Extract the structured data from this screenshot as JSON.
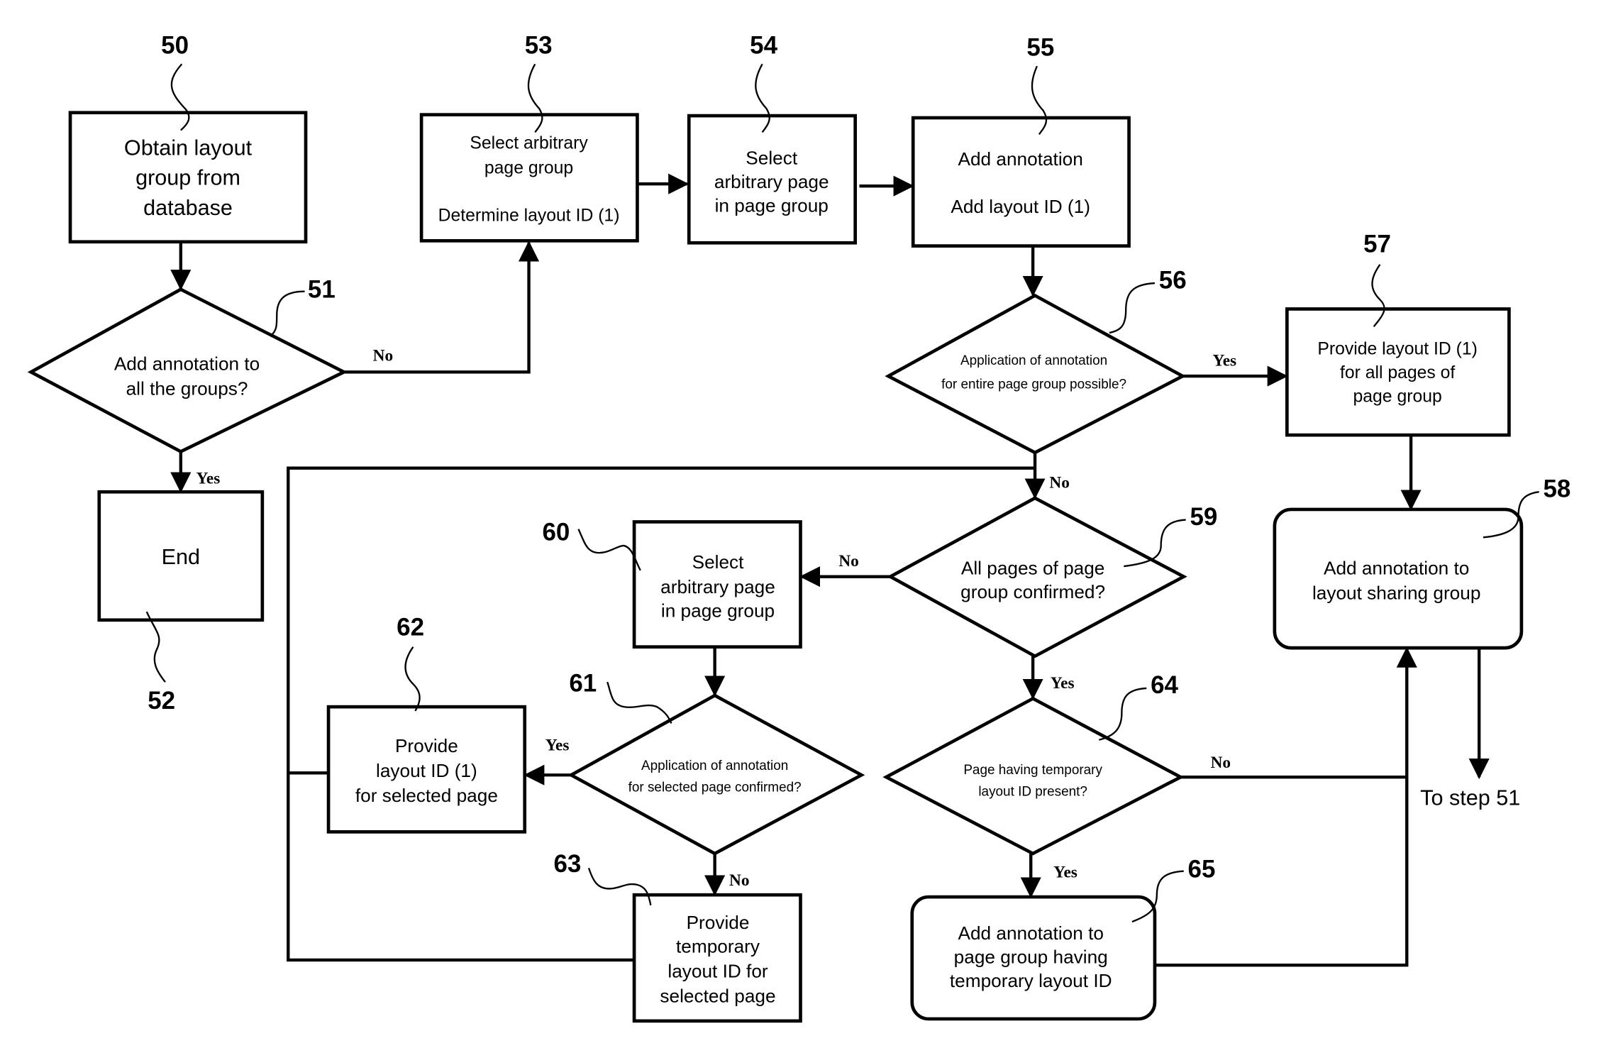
{
  "figure": {
    "type": "flowchart",
    "colors": {
      "line": "#000000",
      "background": "#ffffff"
    }
  },
  "steps": {
    "s50": {
      "ref": "50",
      "shape": "process",
      "lines": [
        "Obtain layout",
        "group from",
        "database"
      ]
    },
    "s51": {
      "ref": "51",
      "shape": "decision",
      "lines": [
        "Add annotation to",
        "all the groups?"
      ]
    },
    "s52": {
      "ref": "52",
      "shape": "terminal",
      "lines": [
        "End"
      ]
    },
    "s53": {
      "ref": "53",
      "shape": "process",
      "lines": [
        "Select arbitrary",
        "page group",
        "Determine layout ID (1)"
      ]
    },
    "s54": {
      "ref": "54",
      "shape": "process",
      "lines": [
        "Select",
        "arbitrary page",
        "in page group"
      ]
    },
    "s55": {
      "ref": "55",
      "shape": "process",
      "lines": [
        "Add annotation",
        "Add layout ID (1)"
      ]
    },
    "s56": {
      "ref": "56",
      "shape": "decision",
      "lines": [
        "Application of annotation",
        "for entire page group possible?"
      ]
    },
    "s57": {
      "ref": "57",
      "shape": "process",
      "lines": [
        "Provide layout ID (1)",
        "for all pages of",
        "page group"
      ]
    },
    "s58": {
      "ref": "58",
      "shape": "rounded-process",
      "lines": [
        "Add annotation to",
        "layout sharing group"
      ]
    },
    "s59": {
      "ref": "59",
      "shape": "decision",
      "lines": [
        "All pages of page",
        "group confirmed?"
      ]
    },
    "s60": {
      "ref": "60",
      "shape": "process",
      "lines": [
        "Select",
        "arbitrary page",
        "in page group"
      ]
    },
    "s61": {
      "ref": "61",
      "shape": "decision",
      "lines": [
        "Application of annotation",
        "for selected page confirmed?"
      ]
    },
    "s62": {
      "ref": "62",
      "shape": "process",
      "lines": [
        "Provide",
        "layout ID (1)",
        "for selected page"
      ]
    },
    "s63": {
      "ref": "63",
      "shape": "process",
      "lines": [
        "Provide",
        "temporary",
        "layout ID for",
        "selected page"
      ]
    },
    "s64": {
      "ref": "64",
      "shape": "decision",
      "lines": [
        "Page having temporary",
        "layout ID present?"
      ]
    },
    "s65": {
      "ref": "65",
      "shape": "rounded-process",
      "lines": [
        "Add annotation to",
        "page group having",
        "temporary layout ID"
      ]
    }
  },
  "branch_labels": {
    "s51_no": "No",
    "s51_yes": "Yes",
    "s56_yes": "Yes",
    "s56_no": "No",
    "s59_no": "No",
    "s59_yes": "Yes",
    "s61_yes": "Yes",
    "s61_no": "No",
    "s64_no": "No",
    "s64_yes": "Yes"
  },
  "connectors": [
    {
      "from": "50",
      "to": "51"
    },
    {
      "from": "51",
      "to": "53",
      "label": "No"
    },
    {
      "from": "51",
      "to": "52",
      "label": "Yes"
    },
    {
      "from": "53",
      "to": "54"
    },
    {
      "from": "54",
      "to": "55"
    },
    {
      "from": "55",
      "to": "56"
    },
    {
      "from": "56",
      "to": "57",
      "label": "Yes"
    },
    {
      "from": "56",
      "to": "59",
      "label": "No"
    },
    {
      "from": "57",
      "to": "58"
    },
    {
      "from": "59",
      "to": "60",
      "label": "No"
    },
    {
      "from": "59",
      "to": "64",
      "label": "Yes"
    },
    {
      "from": "60",
      "to": "61"
    },
    {
      "from": "61",
      "to": "62",
      "label": "Yes"
    },
    {
      "from": "61",
      "to": "63",
      "label": "No"
    },
    {
      "from": "62",
      "to": "59"
    },
    {
      "from": "63",
      "to": "59"
    },
    {
      "from": "64",
      "to": "58",
      "label": "No"
    },
    {
      "from": "64",
      "to": "65",
      "label": "Yes"
    },
    {
      "from": "65",
      "to": "58"
    },
    {
      "from": "58",
      "to": "51"
    }
  ],
  "offpage": {
    "to_step_label": "To step 51"
  }
}
